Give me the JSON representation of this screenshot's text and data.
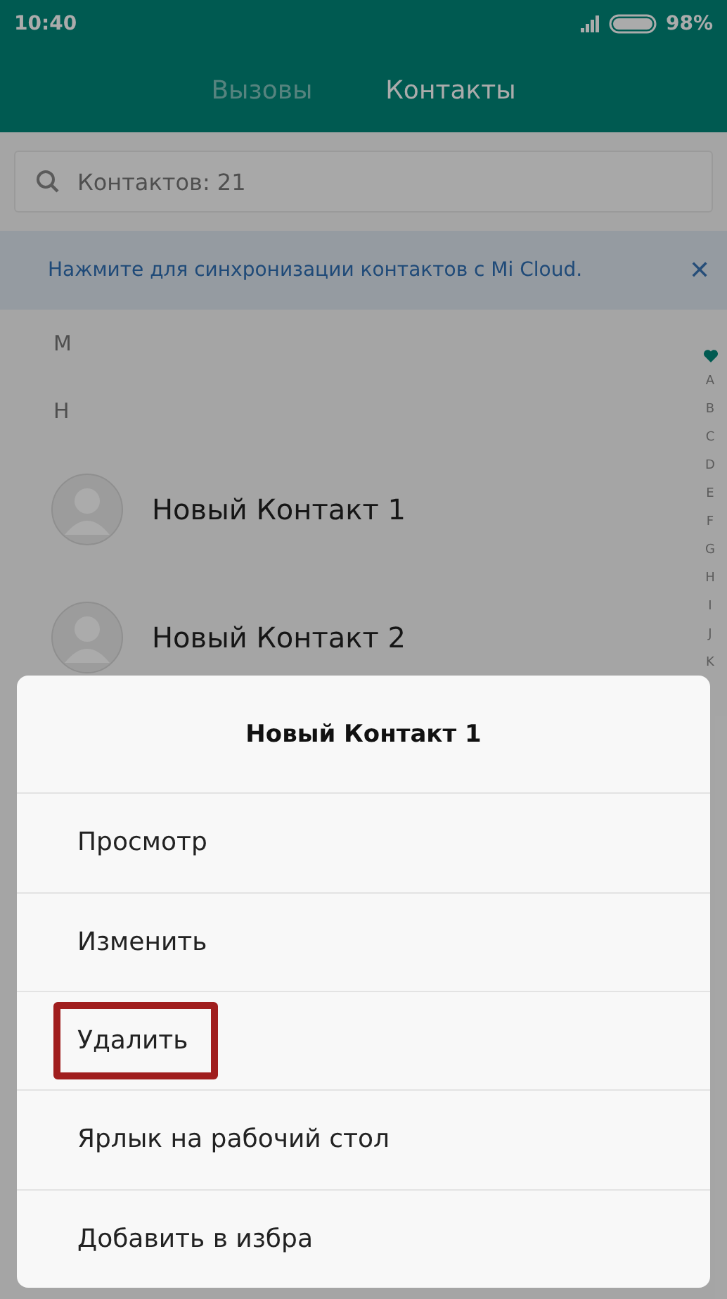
{
  "status_bar": {
    "time": "10:40",
    "battery": "98%"
  },
  "tabs": [
    {
      "label": "Вызовы",
      "selected": false
    },
    {
      "label": "Контакты",
      "selected": true
    }
  ],
  "search": {
    "placeholder": "Контактов: 21"
  },
  "sync_banner": {
    "text": "Нажмите для синхронизации контактов с Mi Cloud.",
    "close": "✕"
  },
  "sections": [
    {
      "letter": "М"
    },
    {
      "letter": "Н",
      "contacts": [
        {
          "name": "Новый Контакт 1"
        },
        {
          "name": "Новый Контакт 2"
        }
      ]
    }
  ],
  "index": [
    "A",
    "B",
    "C",
    "D",
    "E",
    "F",
    "G",
    "H",
    "I",
    "J",
    "K"
  ],
  "sheet": {
    "title": "Новый Контакт 1",
    "items": [
      {
        "label": "Просмотр",
        "highlighted": false
      },
      {
        "label": "Изменить",
        "highlighted": false
      },
      {
        "label": "Удалить",
        "highlighted": true
      },
      {
        "label": "Ярлык на рабочий стол",
        "highlighted": false
      },
      {
        "label": "Добавить в избра",
        "highlighted": false
      }
    ]
  }
}
